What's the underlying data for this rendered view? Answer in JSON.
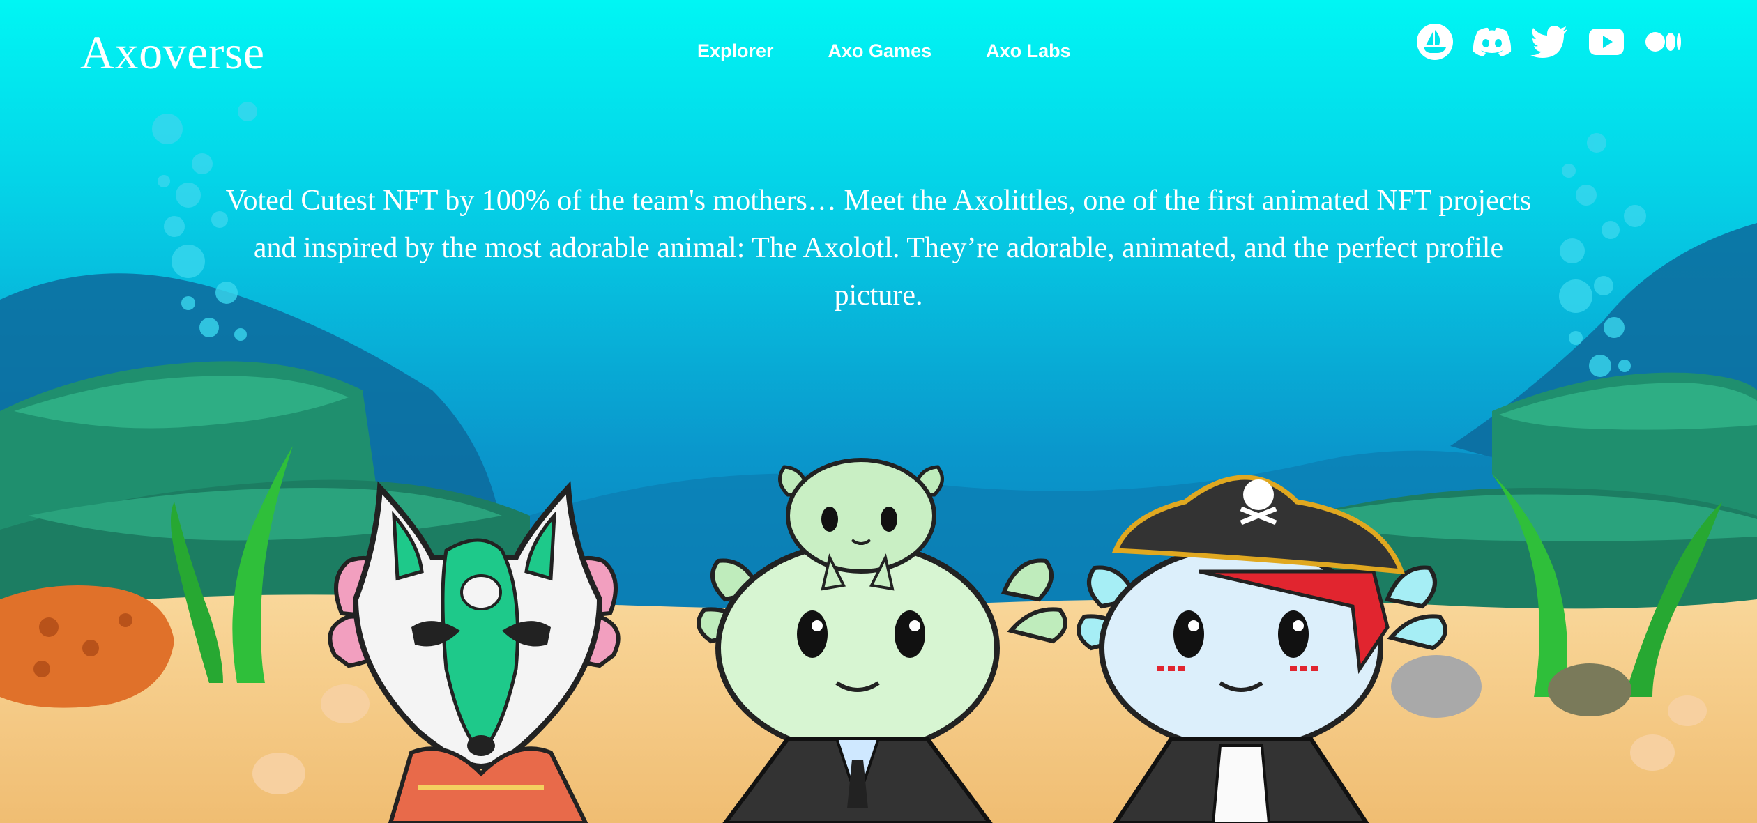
{
  "header": {
    "brand": "Axoverse",
    "nav": [
      {
        "label": "Explorer"
      },
      {
        "label": "Axo Games"
      },
      {
        "label": "Axo Labs"
      }
    ],
    "socials": [
      {
        "icon": "opensea-icon"
      },
      {
        "icon": "discord-icon"
      },
      {
        "icon": "twitter-icon"
      },
      {
        "icon": "youtube-icon"
      },
      {
        "icon": "medium-icon"
      }
    ]
  },
  "hero": {
    "description": "Voted Cutest NFT by 100% of the team's mothers… Meet the Axolittles, one of the first animated NFT projects and inspired by the most adorable animal: The Axolotl. They’re adorable, animated, and the perfect profile picture."
  },
  "colors": {
    "sky_top": "#00f6f4",
    "water_mid": "#0aa6d6",
    "water_deep": "#0a6fb0",
    "sand": "#f3c781",
    "text": "#ffffff"
  }
}
